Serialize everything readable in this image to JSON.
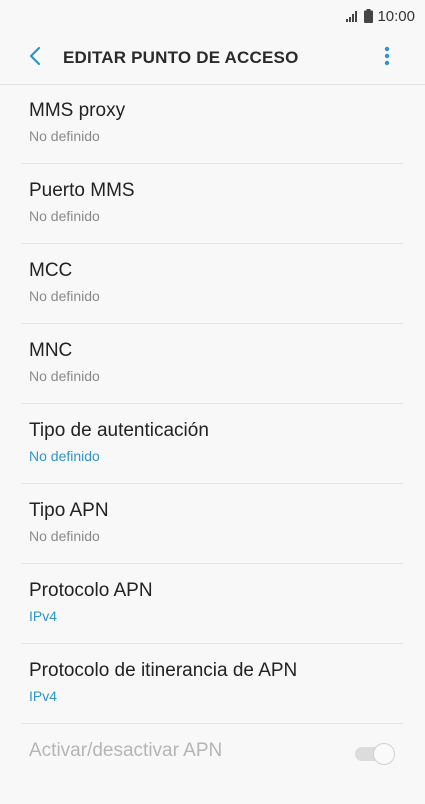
{
  "status_bar": {
    "time": "10:00",
    "signal_icon": "signal-icon",
    "battery_icon": "battery-icon"
  },
  "app_bar": {
    "title": "EDITAR PUNTO DE ACCESO",
    "back_icon": "back-arrow-icon",
    "more_icon": "more-vert-icon"
  },
  "colors": {
    "accent": "#2f94c9",
    "secondary_text": "#8a8a8a",
    "disabled_text": "#b5b5b5"
  },
  "items": [
    {
      "label": "MMS proxy",
      "value": "No definido"
    },
    {
      "label": "Puerto MMS",
      "value": "No definido"
    },
    {
      "label": "MCC",
      "value": "No definido"
    },
    {
      "label": "MNC",
      "value": "No definido"
    },
    {
      "label": "Tipo de autenticación",
      "value": "No definido"
    },
    {
      "label": "Tipo APN",
      "value": "No definido"
    },
    {
      "label": "Protocolo APN",
      "value": "IPv4"
    },
    {
      "label": "Protocolo de itinerancia de APN",
      "value": "IPv4"
    },
    {
      "label": "Activar/desactivar APN",
      "toggle_state": "on"
    }
  ]
}
